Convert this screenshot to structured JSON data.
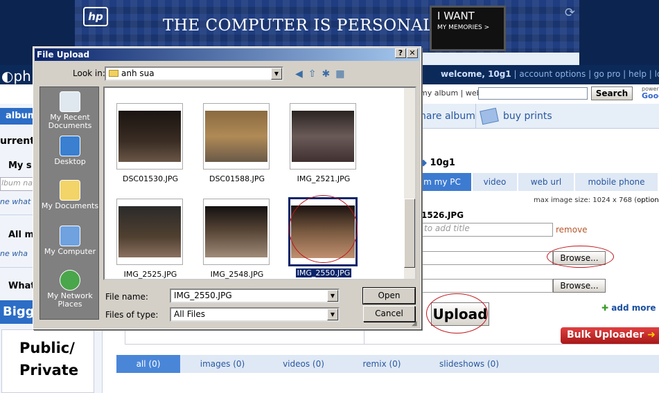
{
  "ad": {
    "brand": "hp",
    "tagline": "THE COMPUTER IS PERSONAL AGAIN.",
    "monitor_line1": "I WANT",
    "monitor_line2": "MY MEMORIES >"
  },
  "header": {
    "logo": "ph",
    "welcome": "welcome, 10g1",
    "links": [
      "account options",
      "go pro",
      "help",
      "logo"
    ]
  },
  "search": {
    "scope": "my album | web",
    "button": "Search",
    "powered": "powere",
    "google": "Goog"
  },
  "tabs": {
    "share_album": "hare album",
    "buy_prints": "buy prints"
  },
  "left": {
    "album_tab": "album",
    "current": "urrent a",
    "my_s": "My s",
    "album_name_placeholder": "lbum nam",
    "ne_what": "ne  what",
    "all_m": "All m",
    "ne_what2": "ne  wha",
    "what": "What",
    "bigge": "Bigge",
    "promo_line1": "Public/",
    "promo_line2": "Private"
  },
  "upload": {
    "user": "10g1",
    "tabs": [
      "m my PC",
      "video",
      "web url",
      "mobile phone"
    ],
    "max_size": "max image size: 1024 x 768 (",
    "options": "options",
    "max_close": ")",
    "filename": "1526.JPG",
    "title_placeholder": "to add title",
    "remove": "remove",
    "browse1": "Browse...",
    "browse2": "Browse...",
    "upload_btn": "Upload",
    "add_more": "add more",
    "bulk": "Bulk Uploader"
  },
  "filetabs": [
    "all (0)",
    "images (0)",
    "videos (0)",
    "remix (0)",
    "slideshows (0)"
  ],
  "dialog": {
    "title": "File Upload",
    "help": "?",
    "close": "✕",
    "look_in_label": "Look in:",
    "look_in_value": "anh sua",
    "places": [
      "My Recent Documents",
      "Desktop",
      "My Documents",
      "My Computer",
      "My Network Places"
    ],
    "files": [
      "DSC01530.JPG",
      "DSC01588.JPG",
      "IMG_2521.JPG",
      "IMG_2525.JPG",
      "IMG_2548.JPG",
      "IMG_2550.JPG"
    ],
    "file_name_label": "File name:",
    "file_name_value": "IMG_2550.JPG",
    "file_type_label": "Files of type:",
    "file_type_value": "All Files",
    "open": "Open",
    "cancel": "Cancel"
  },
  "colors": {
    "accent": "#2c6dc6",
    "highlight_ellipse": "#c0141a",
    "bulk": "#c8201f",
    "add_more": "#1a4fa0"
  }
}
